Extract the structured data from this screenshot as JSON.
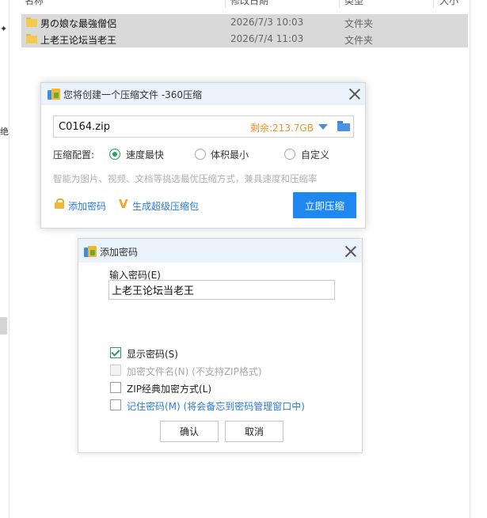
{
  "explorer": {
    "headers": {
      "name": "名称",
      "date": "修改日期",
      "type": "类型",
      "size": "大小"
    },
    "left_chars": [
      "✦",
      "绝"
    ],
    "rows": [
      {
        "name": "男の娘な最強僧侶",
        "date": "2026/7/3 10:03",
        "type": "文件夹"
      },
      {
        "name": "上老王论坛当老王",
        "date": "2026/7/4 11:03",
        "type": "文件夹"
      }
    ]
  },
  "compress_dialog": {
    "title": "您将创建一个压缩文件 -360压缩",
    "filename": "C0164.zip",
    "remaining": "剩余:213.7GB",
    "level_label": "压缩配置:",
    "levels": [
      {
        "label": "速度最快",
        "selected": true
      },
      {
        "label": "体积最小",
        "selected": false
      },
      {
        "label": "自定义",
        "selected": false
      }
    ],
    "hint": "智能为图片、视频、文档等挑选最优压缩方式，兼具速度和压缩率",
    "add_password": "添加密码",
    "super_pack": "生成超级压缩包",
    "compress_now": "立即压缩",
    "colors": {
      "accent": "#1e88f0",
      "remain": "#e8932b",
      "radio": "#26a05a"
    }
  },
  "password_dialog": {
    "title": "添加密码",
    "input_label": "输入密码(E)",
    "password_value": "上老王论坛当老王",
    "options": [
      {
        "label": "显示密码(S)",
        "checked": true,
        "disabled": false
      },
      {
        "label": "加密文件名(N) (不支持ZIP格式)",
        "checked": false,
        "disabled": true
      },
      {
        "label": "ZIP经典加密方式(L)",
        "checked": false,
        "disabled": false
      },
      {
        "label": "记住密码(M) (将会备忘到密码管理窗口中)",
        "checked": false,
        "disabled": false
      }
    ],
    "ok": "确认",
    "cancel": "取消"
  }
}
